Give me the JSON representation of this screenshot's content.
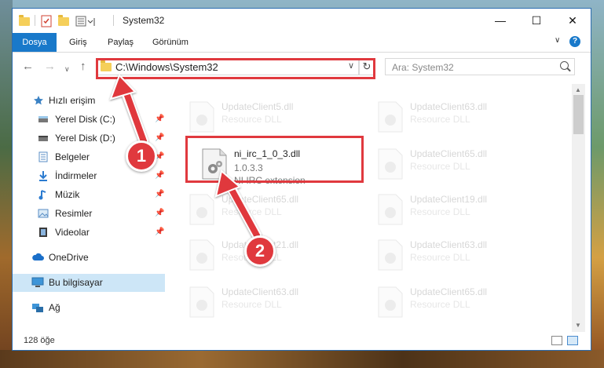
{
  "window": {
    "title": "System32",
    "controls": {
      "minimize": "—",
      "maximize": "☐",
      "close": "✕"
    },
    "help": "?"
  },
  "ribbon": {
    "tabs": [
      {
        "label": "Dosya",
        "active": true
      },
      {
        "label": "Giriş"
      },
      {
        "label": "Paylaş"
      },
      {
        "label": "Görünüm"
      }
    ]
  },
  "nav": {
    "address": "C:\\Windows\\System32",
    "search_placeholder": "Ara: System32"
  },
  "sidebar": {
    "items": [
      {
        "label": "Hızlı erişim",
        "icon": "star-icon",
        "pinned": false
      },
      {
        "label": "Yerel Disk (C:)",
        "icon": "drive-icon",
        "pinned": true
      },
      {
        "label": "Yerel Disk (D:)",
        "icon": "drive-icon",
        "pinned": true
      },
      {
        "label": "Belgeler",
        "icon": "documents-icon",
        "pinned": true
      },
      {
        "label": "İndirmeler",
        "icon": "download-icon",
        "pinned": true
      },
      {
        "label": "Müzik",
        "icon": "music-icon",
        "pinned": true
      },
      {
        "label": "Resimler",
        "icon": "pictures-icon",
        "pinned": true
      },
      {
        "label": "Videolar",
        "icon": "videos-icon",
        "pinned": true
      },
      {
        "label": "OneDrive",
        "icon": "cloud-icon",
        "pinned": false
      },
      {
        "label": "Bu bilgisayar",
        "icon": "computer-icon",
        "pinned": false,
        "selected": true
      },
      {
        "label": "Ağ",
        "icon": "network-icon",
        "pinned": false
      }
    ]
  },
  "files": {
    "selected": {
      "name": "ni_irc_1_0_3.dll",
      "version": "1.0.3.3",
      "description": "NI IRC extension"
    },
    "faded": [
      {
        "name": "UpdateClient5.dll",
        "description": "Resource DLL"
      },
      {
        "name": "UpdateClient63.dll",
        "description": "Resource DLL"
      },
      {
        "name": "UpdateClient65.dll",
        "description": "Resource DLL"
      },
      {
        "name": "UpdateClient65.dll",
        "description": "Resource DLL"
      },
      {
        "name": "UpdateClient19.dll",
        "description": "Resource DLL"
      },
      {
        "name": "UpdateClient21.dll",
        "description": "Resource DLL"
      },
      {
        "name": "UpdateClient63.dll",
        "description": "Resource DLL"
      },
      {
        "name": "UpdateClient63.dll",
        "description": "Resource DLL"
      },
      {
        "name": "UpdateClient65.dll",
        "description": "Resource DLL"
      }
    ]
  },
  "status": {
    "count": "128 öğe"
  },
  "annotations": {
    "badge1": "1",
    "badge2": "2",
    "accent": "#e0393e"
  }
}
